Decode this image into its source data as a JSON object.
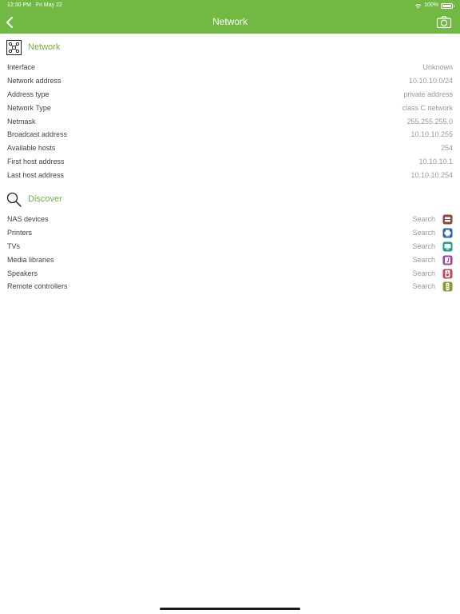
{
  "status_bar": {
    "time": "12:30 PM",
    "date": "Fri May 22",
    "battery": "100%",
    "battery_level": 1.0
  },
  "nav": {
    "title": "Network",
    "back_icon": "chevron-left-icon",
    "camera_icon": "camera-icon"
  },
  "colors": {
    "accent": "#72b944",
    "section_title": "#6fb33f",
    "label": "#444444",
    "value": "#9a9a9a"
  },
  "network": {
    "title": "Network",
    "icon": "network-topology-icon",
    "rows": [
      {
        "label": "Interface",
        "value": "Unknown"
      },
      {
        "label": "Network address",
        "value": "10.10.10.0/24"
      },
      {
        "label": "Address type",
        "value": "private address"
      },
      {
        "label": "Network Type",
        "value": "class C network"
      },
      {
        "label": "Netmask",
        "value": "255.255.255.0"
      },
      {
        "label": "Broadcast address",
        "value": "10.10.10.255"
      },
      {
        "label": "Available hosts",
        "value": "254"
      },
      {
        "label": "First host address",
        "value": "10.10.10.1"
      },
      {
        "label": "Last host address",
        "value": "10.10.10.254"
      }
    ]
  },
  "discover": {
    "title": "Discover",
    "icon": "magnifier-icon",
    "items": [
      {
        "label": "NAS devices",
        "action": "Search",
        "icon": "nas-icon",
        "color": "#8a4b3a"
      },
      {
        "label": "Printers",
        "action": "Search",
        "icon": "printer-icon",
        "color": "#2f5fa8"
      },
      {
        "label": "TVs",
        "action": "Search",
        "icon": "tv-icon",
        "color": "#1f9a8f"
      },
      {
        "label": "Media libraries",
        "action": "Search",
        "icon": "music-icon",
        "color": "#a23da6"
      },
      {
        "label": "Speakers",
        "action": "Search",
        "icon": "speaker-icon",
        "color": "#c0485a"
      },
      {
        "label": "Remote controllers",
        "action": "Search",
        "icon": "remote-icon",
        "color": "#8a9a3a"
      }
    ]
  }
}
